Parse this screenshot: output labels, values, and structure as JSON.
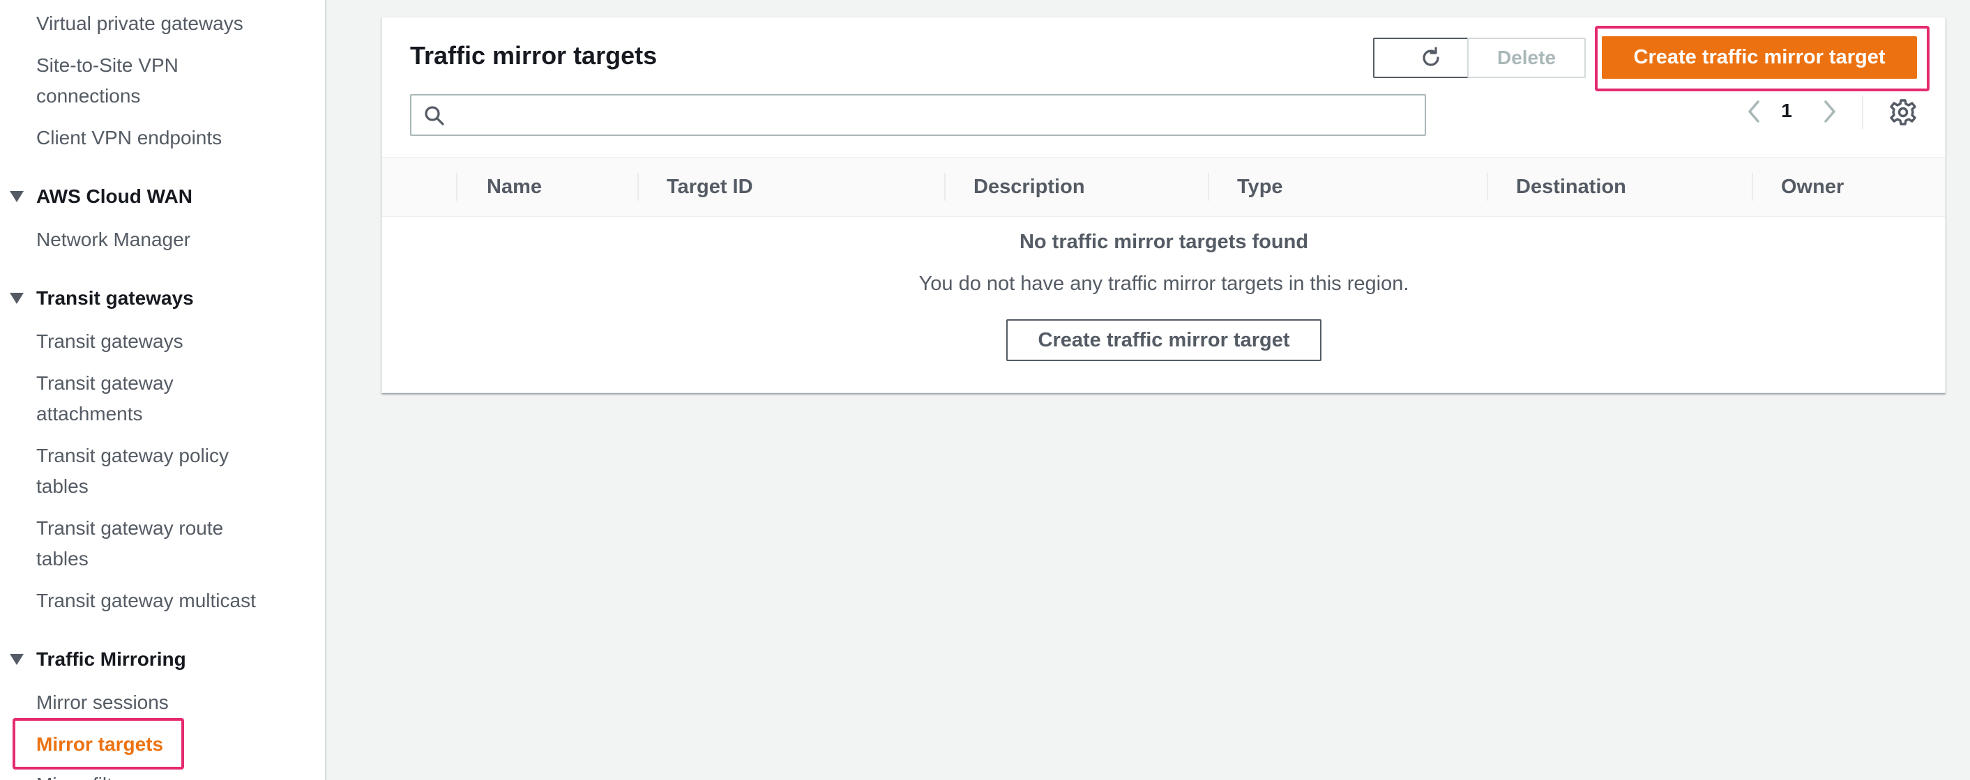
{
  "sidebar": {
    "items_top": [
      {
        "label": "Virtual private gateways"
      },
      {
        "label": "Site-to-Site VPN"
      },
      {
        "label": "connections"
      },
      {
        "label": "Client VPN endpoints"
      }
    ],
    "section_cloud_wan": {
      "heading": "AWS Cloud WAN",
      "items": [
        "Network Manager"
      ]
    },
    "section_transit": {
      "heading": "Transit gateways",
      "items": [
        "Transit gateways",
        "Transit gateway",
        "attachments",
        "Transit gateway policy",
        "tables",
        "Transit gateway route",
        "tables",
        "Transit gateway multicast"
      ]
    },
    "section_mirroring": {
      "heading": "Traffic Mirroring",
      "items": [
        "Mirror sessions",
        "Mirror targets",
        "Mirror filters"
      ],
      "active": "Mirror targets"
    }
  },
  "panel": {
    "title": "Traffic mirror targets",
    "delete_label": "Delete",
    "create_label": "Create traffic mirror target",
    "search": {
      "value": "",
      "placeholder": ""
    },
    "pagination": {
      "current_page": "1"
    },
    "columns": [
      "Name",
      "Target ID",
      "Description",
      "Type",
      "Destination",
      "Owner"
    ],
    "rows": [],
    "empty": {
      "title": "No traffic mirror targets found",
      "description": "You do not have any traffic mirror targets in this region.",
      "button_label": "Create traffic mirror target"
    }
  },
  "colors": {
    "accent": "#ec7211",
    "highlight": "#e52a6f",
    "text": "#16191f",
    "muted": "#545b64"
  },
  "icons": {
    "refresh": "refresh-icon",
    "search": "search-icon",
    "prev": "chevron-left-icon",
    "next": "chevron-right-icon",
    "settings": "gear-icon",
    "section": "caret-down-icon"
  }
}
